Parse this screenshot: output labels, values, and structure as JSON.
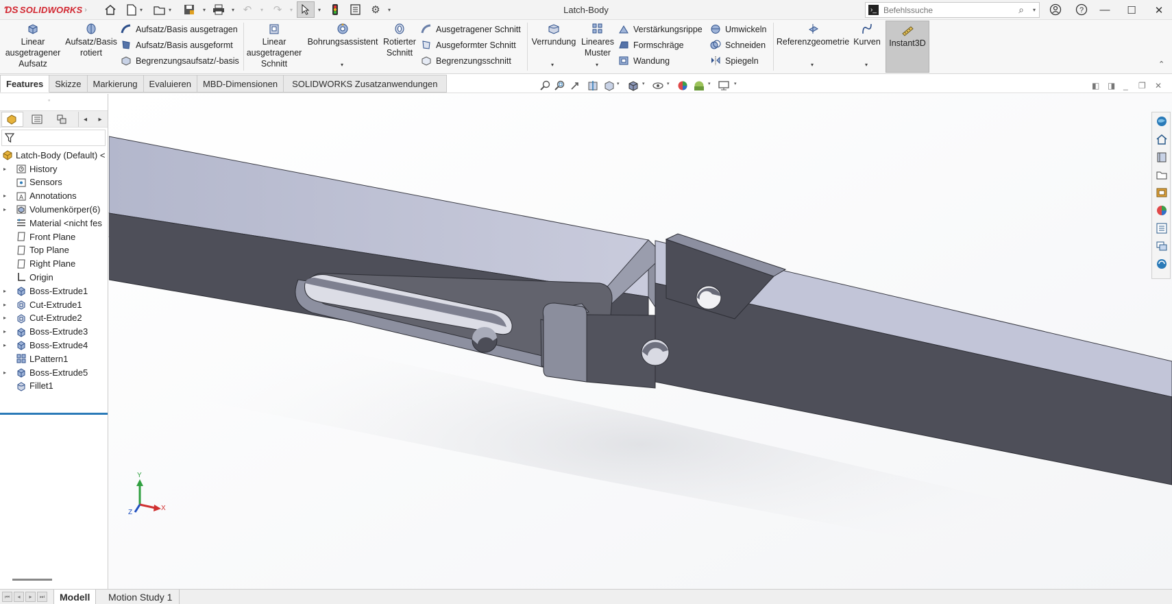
{
  "window": {
    "title": "Latch-Body",
    "logo": "SOLIDWORKS",
    "search_placeholder": "Befehlssuche"
  },
  "ribbon": {
    "big_buttons": [
      {
        "label_lines": [
          "Linear",
          "ausgetragener",
          "Aufsatz"
        ],
        "icon": "extruded-boss-icon"
      },
      {
        "label_lines": [
          "Aufsatz/Basis",
          "rotiert"
        ],
        "icon": "revolved-boss-icon"
      },
      {
        "label_lines": [
          "Linear",
          "ausgetragener",
          "Schnitt"
        ],
        "icon": "extruded-cut-icon"
      },
      {
        "label_lines": [
          "Bohrungsassistent"
        ],
        "icon": "hole-wizard-icon"
      },
      {
        "label_lines": [
          "Rotierter",
          "Schnitt"
        ],
        "icon": "revolved-cut-icon"
      },
      {
        "label_lines": [
          "Verrundung"
        ],
        "icon": "fillet-icon"
      },
      {
        "label_lines": [
          "Lineares",
          "Muster"
        ],
        "icon": "linear-pattern-icon"
      },
      {
        "label_lines": [
          "Referenzgeometrie"
        ],
        "icon": "reference-geometry-icon"
      },
      {
        "label_lines": [
          "Kurven"
        ],
        "icon": "curves-icon"
      },
      {
        "label_lines": [
          "Instant3D"
        ],
        "icon": "instant3d-icon"
      }
    ],
    "small_buttons": [
      "Aufsatz/Basis ausgetragen",
      "Aufsatz/Basis ausgeformt",
      "Begrenzungsaufsatz/-basis",
      "Ausgetragener Schnitt",
      "Ausgeformter Schnitt",
      "Begrenzungsschnitt",
      "Verstärkungsrippe",
      "Formschräge",
      "Wandung",
      "Umwickeln",
      "Schneiden",
      "Spiegeln"
    ]
  },
  "tabs": [
    "Features",
    "Skizze",
    "Markierung",
    "Evaluieren",
    "MBD-Dimensionen",
    "SOLIDWORKS Zusatzanwendungen"
  ],
  "feature_tree": {
    "root": "Latch-Body (Default) <",
    "items": [
      {
        "label": "History",
        "icon": "history-folder-icon",
        "expandable": true
      },
      {
        "label": "Sensors",
        "icon": "sensors-icon",
        "expandable": false
      },
      {
        "label": "Annotations",
        "icon": "annotations-icon",
        "expandable": true
      },
      {
        "label": "Volumenkörper(6)",
        "icon": "solid-bodies-icon",
        "expandable": true
      },
      {
        "label": "Material <nicht fes",
        "icon": "material-icon",
        "expandable": false
      },
      {
        "label": "Front Plane",
        "icon": "plane-icon",
        "expandable": false
      },
      {
        "label": "Top Plane",
        "icon": "plane-icon",
        "expandable": false
      },
      {
        "label": "Right Plane",
        "icon": "plane-icon",
        "expandable": false
      },
      {
        "label": "Origin",
        "icon": "origin-icon",
        "expandable": false
      },
      {
        "label": "Boss-Extrude1",
        "icon": "boss-extrude-icon",
        "expandable": true
      },
      {
        "label": "Cut-Extrude1",
        "icon": "cut-extrude-icon",
        "expandable": true
      },
      {
        "label": "Cut-Extrude2",
        "icon": "cut-extrude-icon",
        "expandable": true
      },
      {
        "label": "Boss-Extrude3",
        "icon": "boss-extrude-icon",
        "expandable": true
      },
      {
        "label": "Boss-Extrude4",
        "icon": "boss-extrude-icon",
        "expandable": true
      },
      {
        "label": "LPattern1",
        "icon": "linear-pattern-icon",
        "expandable": false
      },
      {
        "label": "Boss-Extrude5",
        "icon": "boss-extrude-icon",
        "expandable": true
      },
      {
        "label": "Fillet1",
        "icon": "fillet-icon",
        "expandable": false
      }
    ]
  },
  "triad": {
    "x": "X",
    "y": "Y",
    "z": "Z"
  },
  "bottom_tabs": [
    "Modell",
    "Motion Study 1"
  ],
  "colors": {
    "accent_blue": "#2a7ab8",
    "model_light": "#b9bdd2",
    "model_dark": "#4d4e58",
    "model_mid": "#8a8c9c"
  }
}
